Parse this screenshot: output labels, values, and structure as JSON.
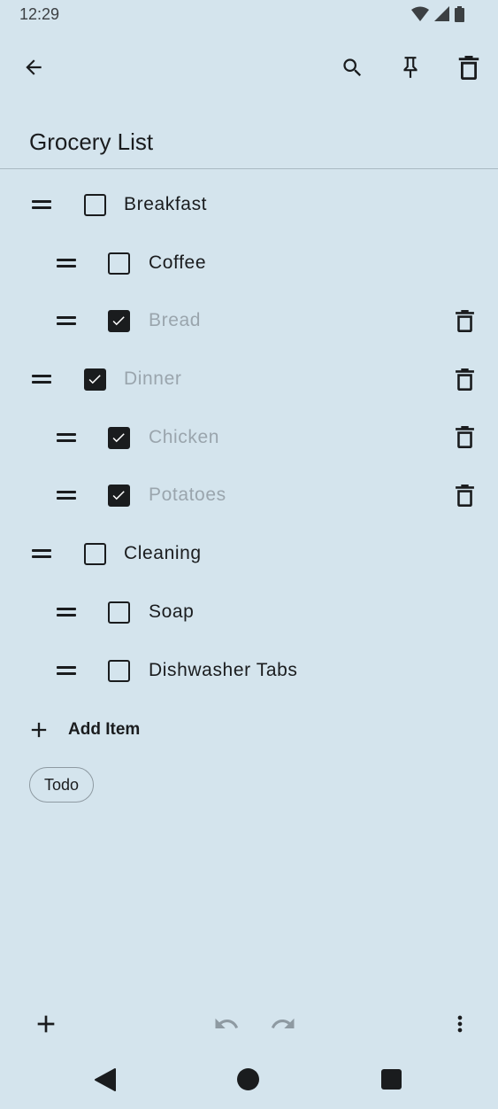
{
  "status_bar": {
    "time": "12:29"
  },
  "note": {
    "title": "Grocery List"
  },
  "items": [
    {
      "label": "Breakfast",
      "checked": false,
      "indent": 0
    },
    {
      "label": "Coffee",
      "checked": false,
      "indent": 1
    },
    {
      "label": "Bread",
      "checked": true,
      "indent": 1
    },
    {
      "label": "Dinner",
      "checked": true,
      "indent": 0
    },
    {
      "label": "Chicken",
      "checked": true,
      "indent": 1
    },
    {
      "label": "Potatoes",
      "checked": true,
      "indent": 1
    },
    {
      "label": "Cleaning",
      "checked": false,
      "indent": 0
    },
    {
      "label": "Soap",
      "checked": false,
      "indent": 1
    },
    {
      "label": "Dishwasher Tabs",
      "checked": false,
      "indent": 1
    }
  ],
  "add_item": {
    "label": "Add Item"
  },
  "labels": [
    "Todo"
  ],
  "icons": {
    "back": "arrow-back-icon",
    "search": "search-icon",
    "pin": "pin-icon",
    "delete": "trash-icon",
    "add": "plus-icon",
    "undo": "undo-icon",
    "redo": "redo-icon",
    "more": "more-vert-icon"
  },
  "colors": {
    "background": "#d4e4ed",
    "text": "#1a1c1e",
    "checked_text": "#9aa5ad",
    "disabled_icon": "#8e9aa2"
  }
}
